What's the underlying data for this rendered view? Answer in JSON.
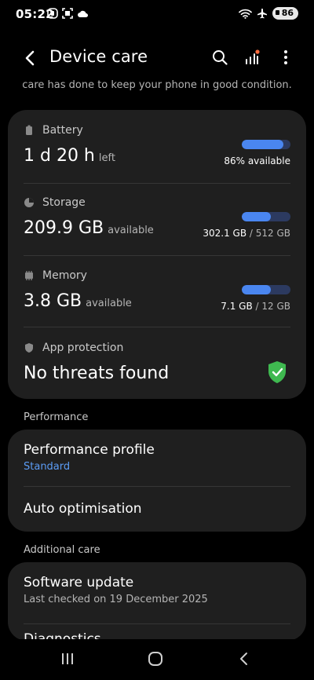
{
  "status_bar": {
    "time": "05:22",
    "battery_level": "86",
    "icons": [
      "notification-icon",
      "screenshot-icon",
      "cloud-icon",
      "wifi-icon",
      "airplane-icon"
    ]
  },
  "app_bar": {
    "title": "Device care",
    "back_icon": "back-arrow-icon",
    "actions": [
      "search-icon",
      "stats-icon",
      "more-options-icon"
    ],
    "accent_dot_color": "#ff6b3d"
  },
  "intro": "care has done to keep your phone in good condition.",
  "main_card": {
    "battery": {
      "label": "Battery",
      "value": "1 d 20 h",
      "unit": "left",
      "usage_fraction": 0.86,
      "caption": "86% available"
    },
    "storage": {
      "label": "Storage",
      "value": "209.9 GB",
      "unit": "available",
      "usage_fraction": 0.59,
      "used": "302.1 GB",
      "total": "/ 512 GB"
    },
    "memory": {
      "label": "Memory",
      "value": "3.8 GB",
      "unit": "available",
      "usage_fraction": 0.59,
      "used": "7.1 GB",
      "total": "/ 12 GB"
    },
    "app_protection": {
      "label": "App protection",
      "status": "No threats found",
      "shield_color": "#3fb950"
    }
  },
  "performance": {
    "header": "Performance",
    "profile_title": "Performance profile",
    "profile_value": "Standard",
    "auto_optimisation": "Auto optimisation",
    "link_color": "#5b9cf5"
  },
  "additional_care": {
    "header": "Additional care",
    "software_update": "Software update",
    "last_checked": "Last checked on 19 December 2025",
    "diagnostics": "Diagnostics"
  },
  "colors": {
    "bar_fill": "#4a86f0",
    "bar_track": "#2c3a60",
    "card_bg": "#1f1f1f"
  }
}
